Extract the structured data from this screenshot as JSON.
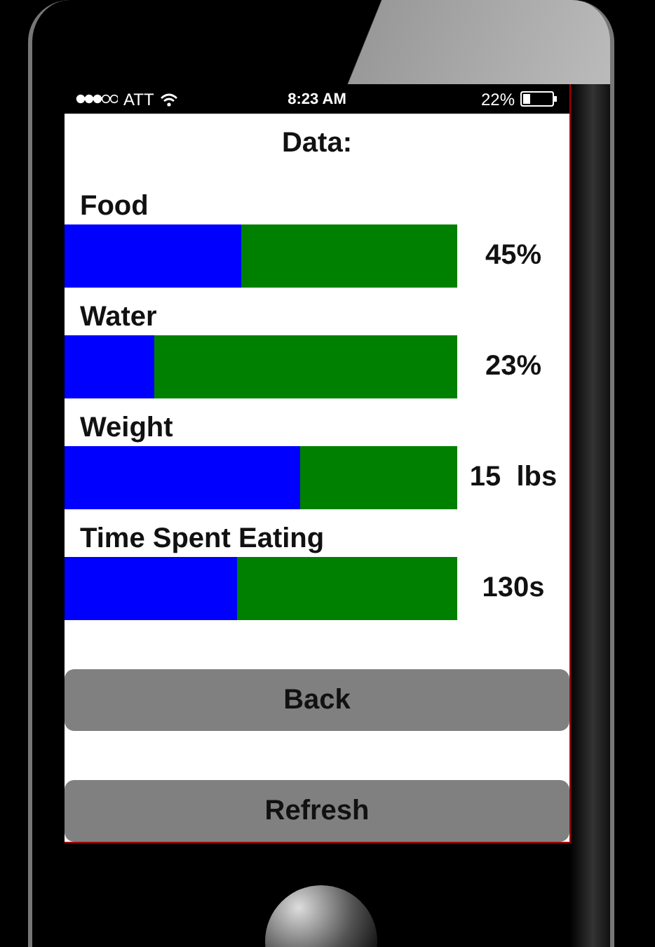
{
  "status_bar": {
    "carrier": "ATT",
    "time": "8:23 AM",
    "battery": "22%"
  },
  "title": "Data:",
  "metrics": [
    {
      "label": "Food",
      "level": 0.45,
      "reading": "45%"
    },
    {
      "label": "Water",
      "level": 0.23,
      "reading": "23%"
    },
    {
      "label": "Weight",
      "level": 0.6,
      "reading": "15  lbs"
    },
    {
      "label": "Time Spent Eating",
      "level": 0.44,
      "reading": "130s"
    }
  ],
  "buttons": [
    "Back",
    "Refresh"
  ]
}
